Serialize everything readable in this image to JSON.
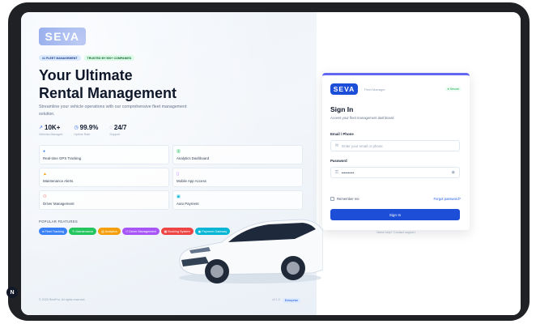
{
  "brand": {
    "logo": "SEVA",
    "accent": "#1d4ed8"
  },
  "hero": {
    "badges": [
      "#1 FLEET MANAGEMENT",
      "TRUSTED BY 500+ COMPANIES"
    ],
    "title_line1": "Your Ultimate",
    "title_line2": "Rental Management",
    "subtitle": "Streamline your vehicle operations with our comprehensive fleet management solution."
  },
  "stats": [
    {
      "value": "10K+",
      "label": "Vehicles Managed",
      "icon": "trend-up-icon"
    },
    {
      "value": "99.9%",
      "label": "Uptime Rate",
      "icon": "clock-icon"
    },
    {
      "value": "24/7",
      "label": "Support",
      "icon": "support-icon"
    }
  ],
  "features": [
    {
      "label": "Real-time GPS Tracking",
      "icon": "location-pin-icon",
      "color": "#3b82f6"
    },
    {
      "label": "Analytics Dashboard",
      "icon": "chart-icon",
      "color": "#22c55e"
    },
    {
      "label": "Maintenance Alerts",
      "icon": "bell-icon",
      "color": "#f59e0b"
    },
    {
      "label": "Mobile App Access",
      "icon": "mobile-icon",
      "color": "#a855f7"
    },
    {
      "label": "Driver Management",
      "icon": "users-icon",
      "color": "#ef4444"
    },
    {
      "label": "Auto Payment",
      "icon": "card-icon",
      "color": "#06b6d4"
    }
  ],
  "popular": {
    "label": "POPULAR FEATURES",
    "tags": [
      {
        "label": "Fleet Tracking",
        "color": "#3b82f6"
      },
      {
        "label": "Maintenance",
        "color": "#22c55e"
      },
      {
        "label": "Analytics",
        "color": "#f59e0b"
      },
      {
        "label": "Driver Management",
        "color": "#a855f7"
      },
      {
        "label": "Booking System",
        "color": "#ef4444"
      },
      {
        "label": "Payment Gateway",
        "color": "#06b6d4"
      }
    ]
  },
  "footer": {
    "copyright": "© 2025 RentPro. All rights reserved.",
    "version": "v2.1.0",
    "edition": "Enterprise"
  },
  "login": {
    "logo": "SEVA",
    "product": "Fleet Manager",
    "secure": "Secure",
    "title": "Sign In",
    "subtitle": "Access your fleet management dashboard",
    "email_label": "Email / Phone",
    "email_placeholder": "Enter your email or phone",
    "password_label": "Password",
    "password_value": "••••••••••",
    "remember": "Remember me",
    "forgot": "Forgot password?",
    "submit": "Sign In",
    "help": "Need help? Contact support"
  },
  "taskbar": {
    "avatar_letter": "N"
  }
}
